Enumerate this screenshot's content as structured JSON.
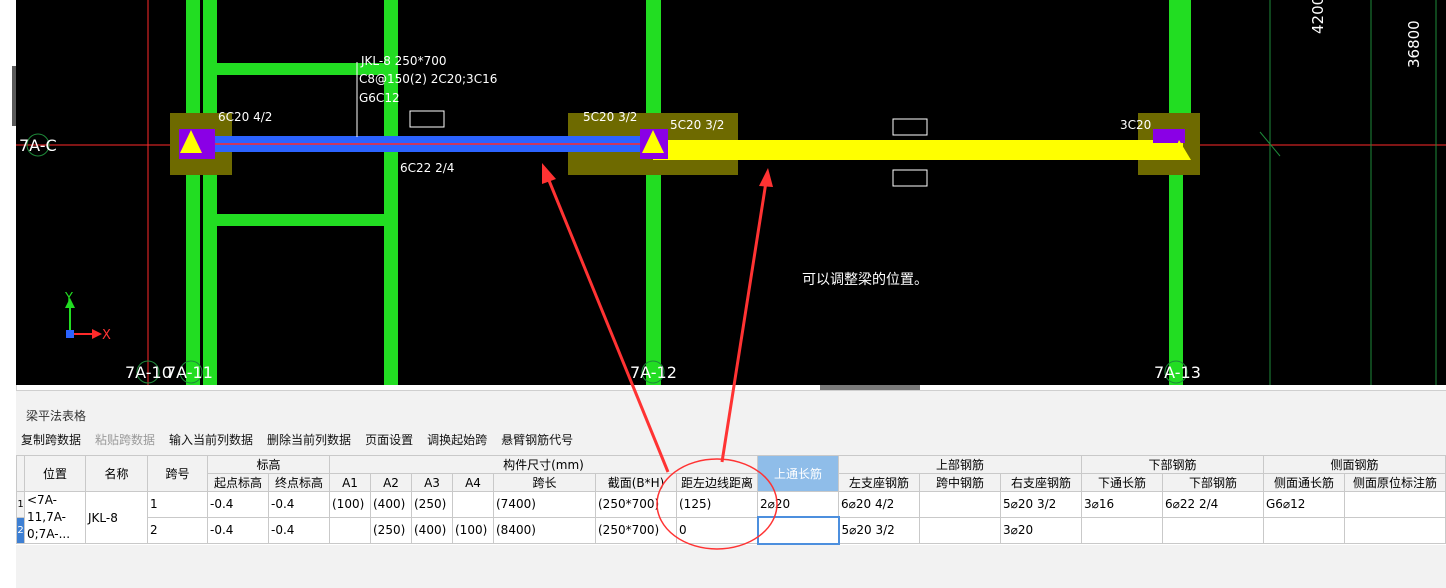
{
  "canvas": {
    "axes": {
      "c": "7A-C",
      "c10": "7A-10",
      "c11": "7A-11",
      "c12": "7A-12",
      "c13": "7A-13"
    },
    "dims": {
      "top1": "4200",
      "top2": "36800"
    },
    "beam_label": {
      "l1": "JKL-8 250*700",
      "l2": "C8@150(2) 2C20;3C16",
      "l3": "G6C12"
    },
    "rebar": {
      "left_top": "6C20 4/2",
      "mid_top1": "5C20 3/2",
      "mid_top2": "5C20 3/2",
      "right_top": "3C20",
      "bottom": "6C22 2/4"
    },
    "note": "可以调整梁的位置。",
    "coord": {
      "x": "X",
      "y": "Y"
    },
    "colors": {
      "background": "#000000",
      "column": "#22dd22",
      "beam_selected": "#2b63ff",
      "beam_highlight": "#ffff00",
      "support": "#6e6a00",
      "marker": "#8a00e6",
      "annotation": "#ff3333"
    }
  },
  "panel": {
    "title": "梁平法表格",
    "toolbar": [
      "复制跨数据",
      "粘贴跨数据",
      "输入当前列数据",
      "删除当前列数据",
      "页面设置",
      "调换起始跨",
      "悬臂钢筋代号"
    ],
    "group_headers": {
      "elev": "标高",
      "size": "构件尺寸(mm)",
      "top": "上部钢筋",
      "bottom": "下部钢筋",
      "side": "侧面钢筋"
    },
    "headers": {
      "pos": "位置",
      "name": "名称",
      "span": "跨号",
      "start_elev": "起点标高",
      "end_elev": "终点标高",
      "a1": "A1",
      "a2": "A2",
      "a3": "A3",
      "a4": "A4",
      "span_len": "跨长",
      "section": "截面(B*H)",
      "offset": "距左边线距离",
      "top_through": "上通长筋",
      "left_sup": "左支座钢筋",
      "mid": "跨中钢筋",
      "right_sup": "右支座钢筋",
      "bot_through": "下通长筋",
      "bot": "下部钢筋",
      "side_through": "侧面通长筋",
      "side_orig": "侧面原位标注筋"
    },
    "rows": [
      {
        "n": "1",
        "pos": "<7A-11,7A-0;7A-...",
        "name": "JKL-8",
        "span": "1",
        "start_elev": "-0.4",
        "end_elev": "-0.4",
        "a1": "(100)",
        "a2": "(400)",
        "a3": "(250)",
        "a4": "",
        "span_len": "(7400)",
        "section": "(250*700)",
        "offset": "(125)",
        "top_through": "2⌀20",
        "left_sup": "6⌀20 4/2",
        "mid": "",
        "right_sup": "5⌀20 3/2",
        "bot_through": "3⌀16",
        "bot": "6⌀22 2/4",
        "side_through": "G6⌀12",
        "side_orig": ""
      },
      {
        "n": "2",
        "span": "2",
        "start_elev": "-0.4",
        "end_elev": "-0.4",
        "a1": "",
        "a2": "(250)",
        "a3": "(400)",
        "a4": "(100)",
        "span_len": "(8400)",
        "section": "(250*700)",
        "offset": "0",
        "top_through": "",
        "left_sup": "5⌀20 3/2",
        "mid": "",
        "right_sup": "3⌀20",
        "bot_through": "",
        "bot": "",
        "side_through": "",
        "side_orig": ""
      }
    ]
  }
}
